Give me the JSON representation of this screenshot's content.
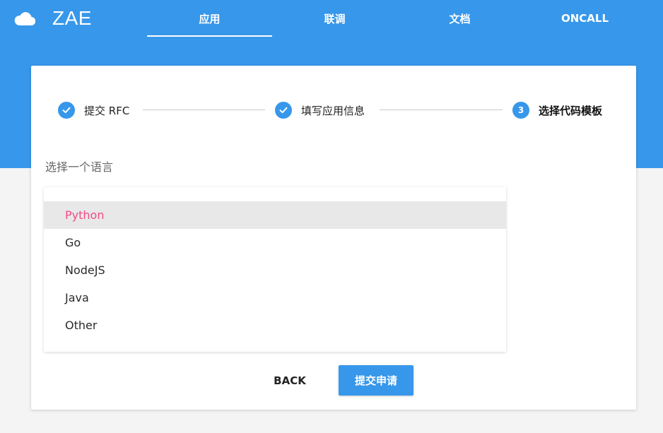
{
  "brand": {
    "name": "ZAE",
    "icon": "cloud-icon"
  },
  "nav": {
    "tabs": [
      {
        "label": "应用",
        "active": true
      },
      {
        "label": "联调",
        "active": false
      },
      {
        "label": "文档",
        "active": false
      },
      {
        "label": "ONCALL",
        "active": false
      }
    ]
  },
  "stepper": {
    "steps": [
      {
        "label": "提交 RFC",
        "status": "completed",
        "icon": "check-icon"
      },
      {
        "label": "填写应用信息",
        "status": "completed",
        "icon": "check-icon"
      },
      {
        "label": "选择代码模板",
        "status": "active",
        "number": "3"
      }
    ]
  },
  "form": {
    "prompt": "选择一个语言",
    "languages": [
      {
        "label": "Python",
        "selected": true
      },
      {
        "label": "Go",
        "selected": false
      },
      {
        "label": "NodeJS",
        "selected": false
      },
      {
        "label": "Java",
        "selected": false
      },
      {
        "label": "Other",
        "selected": false
      }
    ]
  },
  "actions": {
    "back_label": "BACK",
    "submit_label": "提交申请"
  },
  "colors": {
    "primary": "#3797ea",
    "selected_text": "#ee4b87",
    "selected_bg": "#e8e8e8",
    "page_bg": "#f4f4f4"
  }
}
